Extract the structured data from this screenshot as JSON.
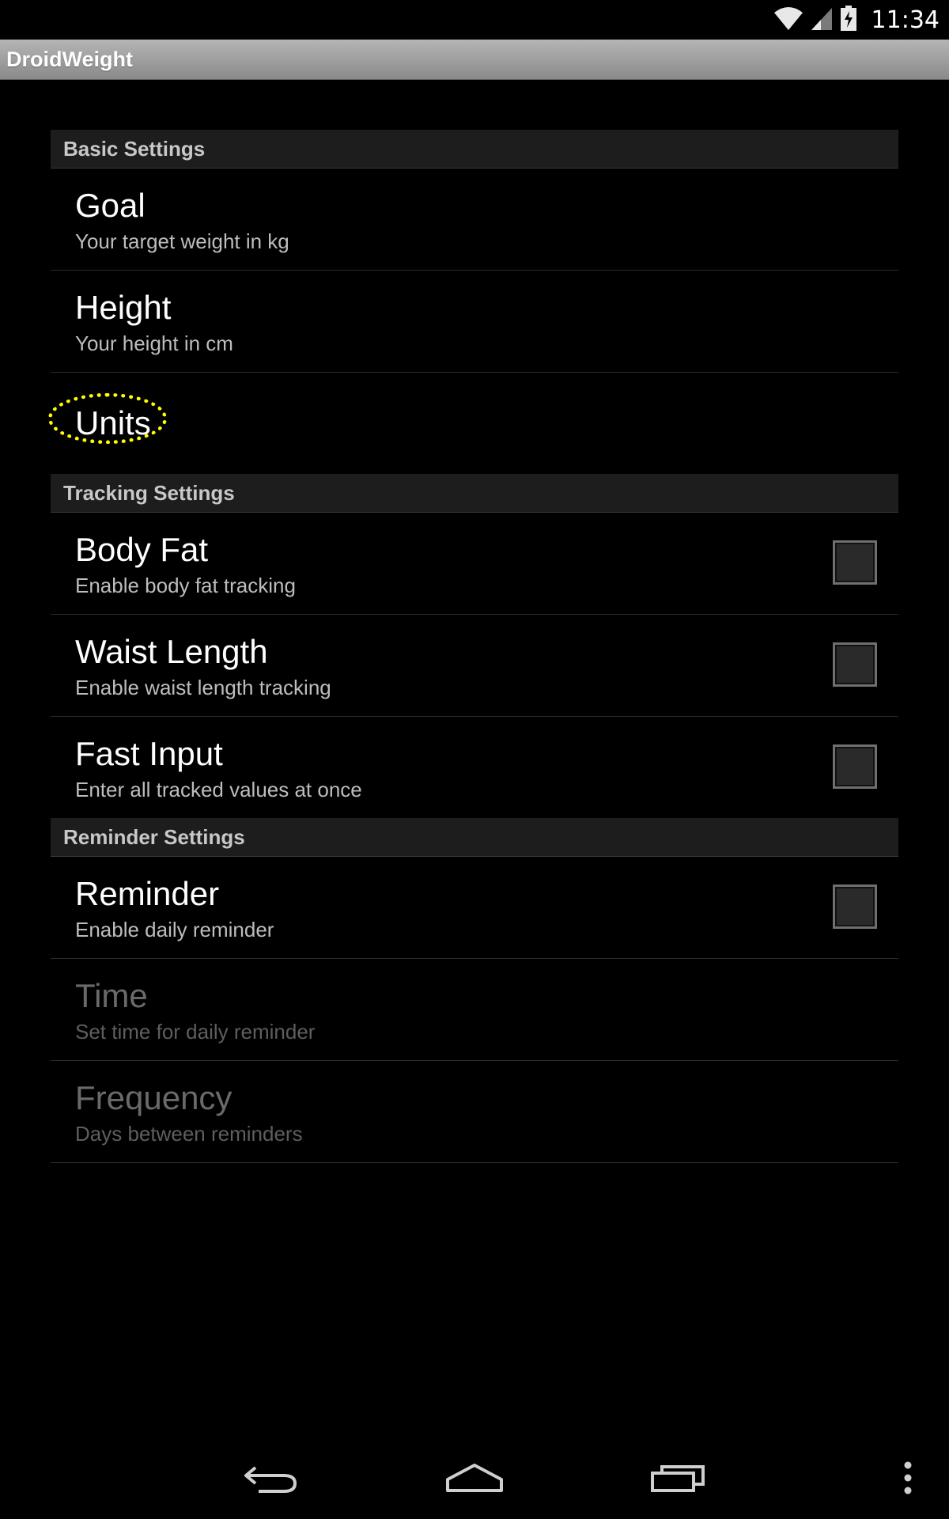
{
  "status_bar": {
    "time": "11:34",
    "icons": [
      "wifi-icon",
      "cell-signal-icon",
      "battery-charging-icon"
    ]
  },
  "action_bar": {
    "title": "DroidWeight"
  },
  "settings": {
    "basic": {
      "header": "Basic Settings",
      "goal": {
        "title": "Goal",
        "summary": "Your target weight in kg"
      },
      "height": {
        "title": "Height",
        "summary": "Your height in cm"
      },
      "units": {
        "title": "Units"
      }
    },
    "tracking": {
      "header": "Tracking Settings",
      "body_fat": {
        "title": "Body Fat",
        "summary": "Enable body fat tracking",
        "checked": false
      },
      "waist_length": {
        "title": "Waist Length",
        "summary": "Enable waist length tracking",
        "checked": false
      },
      "fast_input": {
        "title": "Fast Input",
        "summary": "Enter all tracked values at once",
        "checked": false
      }
    },
    "reminder": {
      "header": "Reminder Settings",
      "reminder": {
        "title": "Reminder",
        "summary": "Enable daily reminder",
        "checked": false
      },
      "time": {
        "title": "Time",
        "summary": "Set time for daily reminder",
        "enabled": false
      },
      "frequency": {
        "title": "Frequency",
        "summary": "Days between reminders",
        "enabled": false
      }
    }
  },
  "nav_bar": {
    "icons": [
      "back-icon",
      "home-icon",
      "recent-apps-icon",
      "overflow-menu-icon"
    ]
  },
  "colors": {
    "background": "#000000",
    "category_bg": "#1d1d1d",
    "highlight": "#ffff00",
    "action_bar": "#9e9e9e"
  }
}
